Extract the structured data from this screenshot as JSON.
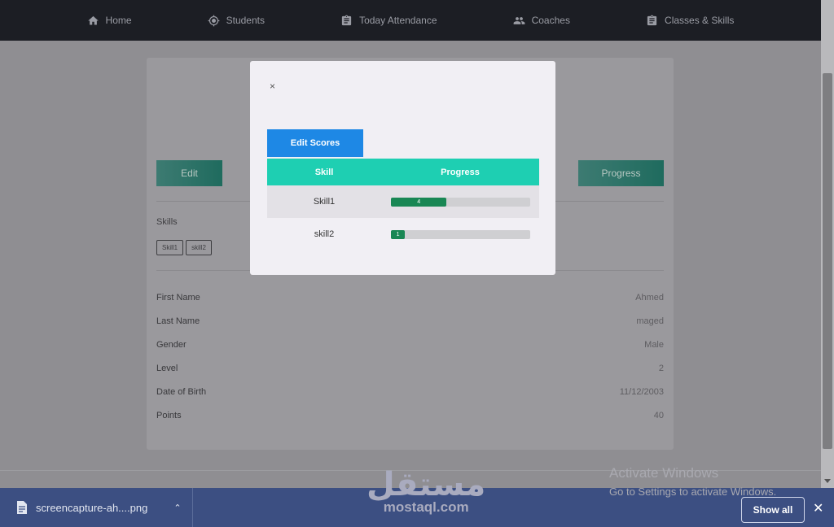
{
  "nav": {
    "items": [
      {
        "label": "Home",
        "icon": "home-icon"
      },
      {
        "label": "Students",
        "icon": "target-icon"
      },
      {
        "label": "Today Attendance",
        "icon": "clipboard-icon"
      },
      {
        "label": "Coaches",
        "icon": "people-icon"
      },
      {
        "label": "Classes & Skills",
        "icon": "clipboard-icon"
      }
    ]
  },
  "profile": {
    "edit_label": "Edit",
    "progress_label": "Progress",
    "skills_label": "Skills",
    "skills": [
      "Skill1",
      "skill2"
    ],
    "fields": [
      {
        "key": "First Name",
        "value": "Ahmed"
      },
      {
        "key": "Last Name",
        "value": "maged"
      },
      {
        "key": "Gender",
        "value": "Male"
      },
      {
        "key": "Level",
        "value": "2"
      },
      {
        "key": "Date of Birth",
        "value": "11/12/2003"
      },
      {
        "key": "Points",
        "value": "40"
      }
    ]
  },
  "modal": {
    "close_label": "×",
    "edit_scores_label": "Edit Scores",
    "col_skill": "Skill",
    "col_progress": "Progress",
    "rows": [
      {
        "skill": "Skill1",
        "score": "4",
        "fraction": 0.4
      },
      {
        "skill": "skill2",
        "score": "1",
        "fraction": 0.1
      }
    ]
  },
  "watermark": {
    "activate_title": "Activate Windows",
    "activate_sub": "Go to Settings to activate Windows.",
    "brand_ar": "مستقل",
    "brand_en": "mostaql.com"
  },
  "downloads": {
    "file_name": "screencapture-ah....png",
    "show_all_label": "Show all",
    "close_label": "✕"
  },
  "colors": {
    "accent_teal": "#1ecfb2",
    "button_blue": "#1e88e5",
    "progress_green": "#198754",
    "nav_bg": "#1c1e24",
    "download_bar": "#3c4f82"
  }
}
